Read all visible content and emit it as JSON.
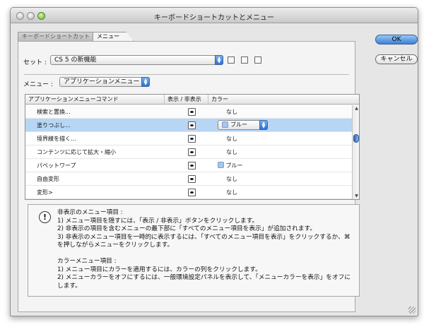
{
  "window": {
    "title": "キーボードショートカットとメニュー"
  },
  "tabs": [
    {
      "label": "キーボードショートカット"
    },
    {
      "label": "メニュー"
    }
  ],
  "set": {
    "label": "セット :",
    "value": "CS 5 の新機能"
  },
  "menu_select": {
    "label": "メニュー :",
    "value": "アプリケーションメニュー"
  },
  "table": {
    "headers": [
      "アプリケーションメニューコマンド",
      "表示 / 非表示",
      "カラー"
    ],
    "rows": [
      {
        "command": "検索と置換...",
        "color": "なし"
      },
      {
        "command": "塗りつぶし...",
        "color": "ブルー"
      },
      {
        "command": "境界線を描く...",
        "color": "なし"
      },
      {
        "command": "コンテンツに応じて拡大・縮小",
        "color": "なし"
      },
      {
        "command": "パペットワープ",
        "color": "ブルー"
      },
      {
        "command": "自由変形",
        "color": "なし"
      },
      {
        "command": "変形>",
        "color": "なし"
      }
    ]
  },
  "info": {
    "lines": [
      "非表示のメニュー項目 :",
      "1) メニュー項目を隠すには、「表示 / 非表示」ボタンをクリックします。",
      "2) 非表示の項目を含むメニューの最下部に「すべてのメニュー項目を表示」が追加されます。",
      "3) 非表示のメニュー項目を一時的に表示するには、「すべてのメニュー項目を表示」をクリックするか、⌘\nを押しながらメニューをクリックします。",
      "",
      "カラーメニュー項目 :",
      "1) メニュー項目にカラーを適用するには、カラーの列をクリックします。",
      "2) メニューカラーをオフにするには、一般環境設定パネルを表示して、「メニューカラーを表示」をオフに\nします。"
    ]
  },
  "buttons": {
    "ok": "OK",
    "cancel": "キャンセル"
  }
}
